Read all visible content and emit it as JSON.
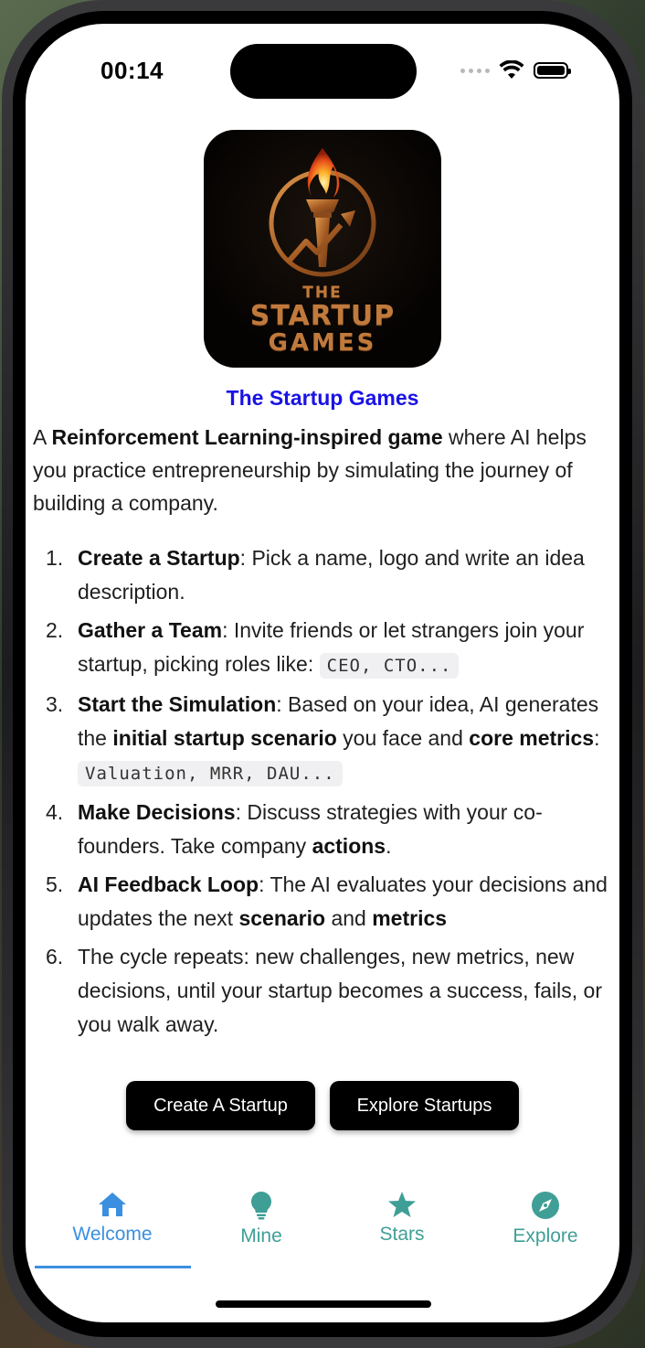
{
  "status_bar": {
    "time": "00:14"
  },
  "logo": {
    "line1": "THE",
    "line2": "STARTUP",
    "line3": "GAMES"
  },
  "app_title": "The Startup Games",
  "intro": {
    "prefix": "A ",
    "bold": "Reinforcement Learning-inspired game",
    "suffix": " where AI helps you practice entrepreneurship by simulating the journey of building a company."
  },
  "steps": [
    {
      "num": "1.",
      "title": "Create a Startup",
      "text": ": Pick a name, logo and write an idea description."
    },
    {
      "num": "2.",
      "title": "Gather a Team",
      "text": ": Invite friends or let strangers join your startup, picking roles like: ",
      "code": "CEO, CTO..."
    },
    {
      "num": "3.",
      "title": "Start the Simulation",
      "text_a": ": Based on your idea, AI generates the ",
      "bold_a": "initial startup scenario",
      "text_b": " you face and ",
      "bold_b": "core metrics",
      "text_c": ": ",
      "code": "Valuation, MRR, DAU..."
    },
    {
      "num": "4.",
      "title": "Make Decisions",
      "text_a": ": Discuss strategies with your co-founders. Take company ",
      "bold_a": "actions",
      "text_b": "."
    },
    {
      "num": "5.",
      "title": "AI Feedback Loop",
      "text_a": ": The AI evaluates your decisions and updates the next ",
      "bold_a": "scenario",
      "text_b": " and ",
      "bold_b": "metrics"
    },
    {
      "num": "6.",
      "text": "The cycle repeats: new challenges, new metrics, new decisions, until your startup becomes a success, fails, or you walk away."
    }
  ],
  "buttons": {
    "create": "Create A Startup",
    "explore": "Explore Startups"
  },
  "tabs": [
    {
      "label": "Welcome",
      "icon": "home-icon",
      "active": true
    },
    {
      "label": "Mine",
      "icon": "lightbulb-icon",
      "active": false
    },
    {
      "label": "Stars",
      "icon": "star-icon",
      "active": false
    },
    {
      "label": "Explore",
      "icon": "compass-icon",
      "active": false
    }
  ],
  "colors": {
    "title": "#1a12e6",
    "tab_active": "#3b8fe0",
    "tab_inactive": "#3f9f96",
    "button_bg": "#000000"
  }
}
